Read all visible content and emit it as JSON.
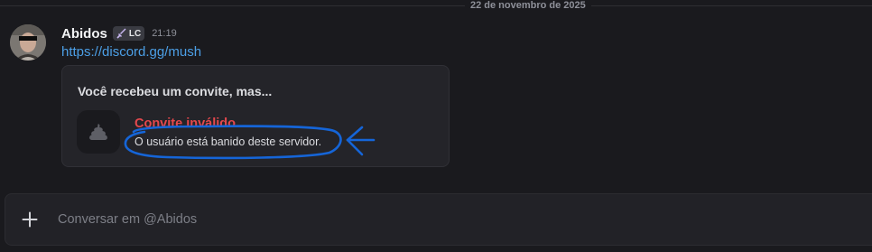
{
  "date_divider": "22 de novembro de 2025",
  "message": {
    "author": "Abidos",
    "tag_label": "LC",
    "tag_icon": "sword-icon",
    "time": "21:19",
    "link_text": "https://discord.gg/mush"
  },
  "invite": {
    "title": "Você recebeu um convite, mas...",
    "status": "Convite inválido",
    "description": "O usuário está banido deste servidor.",
    "icon": "poop-icon"
  },
  "composer": {
    "placeholder": "Conversar em @Abidos",
    "add_icon": "plus-icon"
  },
  "annotation": {
    "color": "#1565d8",
    "shape": "ellipse-and-arrow"
  },
  "colors": {
    "background": "#1a1a1e",
    "link": "#4c9fe6",
    "error": "#e5484d"
  }
}
